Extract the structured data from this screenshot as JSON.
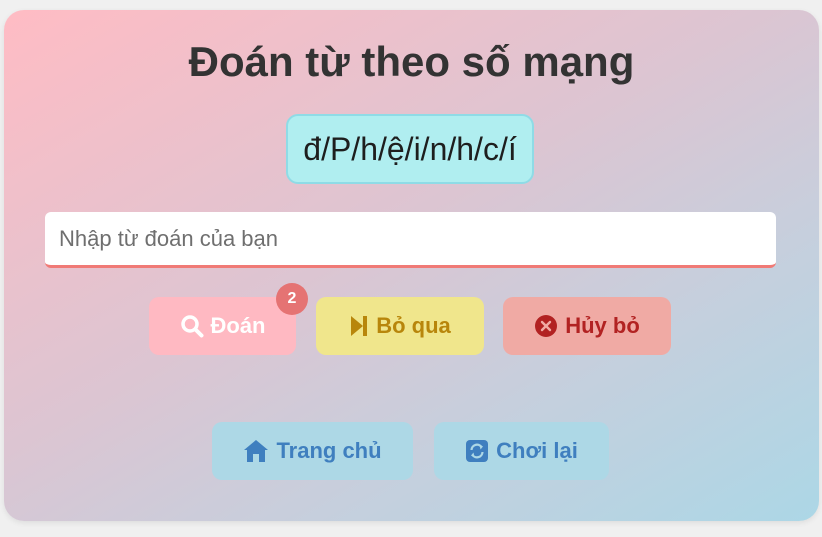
{
  "game": {
    "title": "Đoán từ theo số mạng",
    "clue": "đ/P/h/ệ/i/n/h/c/í"
  },
  "input": {
    "placeholder": "Nhập từ đoán của bạn",
    "value": ""
  },
  "actions": {
    "guess_label": "Đoán",
    "guess_badge": "2",
    "skip_label": "Bỏ qua",
    "cancel_label": "Hủy bỏ"
  },
  "navigation": {
    "home_label": "Trang chủ",
    "replay_label": "Chơi lại"
  },
  "icons": {
    "guess": "search-icon",
    "skip": "step-forward-icon",
    "cancel": "times-circle-icon",
    "home": "home-icon",
    "replay": "sync-icon"
  },
  "colors": {
    "title": "#333333",
    "clue_background": "#b0eef0",
    "input_underline": "#f07a76",
    "guess_button": "#ffb9c2",
    "skip_button": "#f0e68c",
    "cancel_button": "#f0aaa4",
    "nav_button": "#add8e6",
    "badge": "#e57373"
  }
}
